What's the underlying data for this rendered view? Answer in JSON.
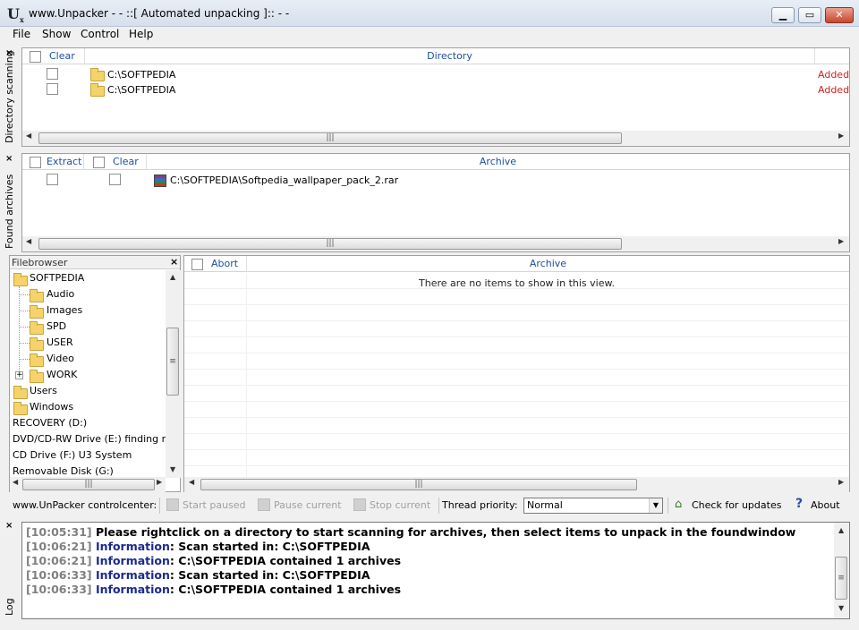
{
  "window": {
    "icon_text": "U",
    "icon_sub": "x",
    "title": "www.Unpacker - - ::[ Automated unpacking ]:: - -"
  },
  "menu": [
    "File",
    "Show",
    "Control",
    "Help"
  ],
  "directory_panel": {
    "side_label": "Directory scanning",
    "clear_label": "Clear",
    "directory_label": "Directory",
    "rows": [
      {
        "path": "C:\\SOFTPEDIA",
        "status": "Added"
      },
      {
        "path": "C:\\SOFTPEDIA",
        "status": "Added"
      }
    ]
  },
  "archives_panel": {
    "side_label": "Found archives",
    "extract_label": "Extract",
    "clear_label": "Clear",
    "archive_label": "Archive",
    "rows": [
      {
        "path": "C:\\SOFTPEDIA\\Softpedia_wallpaper_pack_2.rar"
      }
    ]
  },
  "filebrowser": {
    "title": "Filebrowser",
    "items": [
      {
        "label": "SOFTPEDIA",
        "folder": true
      },
      {
        "label": "Audio",
        "folder": true
      },
      {
        "label": "Images",
        "folder": true
      },
      {
        "label": "SPD",
        "folder": true
      },
      {
        "label": "USER",
        "folder": true
      },
      {
        "label": "Video",
        "folder": true
      },
      {
        "label": "WORK",
        "folder": true
      },
      {
        "label": "Users",
        "folder": true
      },
      {
        "label": "Windows",
        "folder": true
      },
      {
        "label": "RECOVERY (D:)",
        "folder": false
      },
      {
        "label": "DVD/CD-RW Drive (E:) finding ne",
        "folder": false
      },
      {
        "label": "CD Drive (F:) U3 System",
        "folder": false
      },
      {
        "label": "Removable Disk (G:)",
        "folder": false
      }
    ]
  },
  "unpack_panel": {
    "abort_label": "Abort",
    "archive_label": "Archive",
    "empty_text": "There are no items to show in this view."
  },
  "toolbar": {
    "controlcenter_label": "www.UnPacker controlcenter:",
    "start_paused": "Start paused",
    "pause_current": "Pause current",
    "stop_current": "Stop current",
    "thread_priority_label": "Thread priority:",
    "thread_priority_value": "Normal",
    "check_updates": "Check for updates",
    "about": "About"
  },
  "log": {
    "side_label": "Log",
    "lines": [
      {
        "time": "[10:05:31]",
        "kind": "",
        "text": "Please rightclick on a directory to start scanning for archives, then select items to unpack in the foundwindow"
      },
      {
        "time": "[10:06:21]",
        "kind": "Information",
        "text": ": Scan started in: C:\\SOFTPEDIA"
      },
      {
        "time": "[10:06:21]",
        "kind": "Information",
        "text": ": C:\\SOFTPEDIA contained 1 archives"
      },
      {
        "time": "[10:06:33]",
        "kind": "Information",
        "text": ": Scan started in: C:\\SOFTPEDIA"
      },
      {
        "time": "[10:06:33]",
        "kind": "Information",
        "text": ": C:\\SOFTPEDIA contained 1 archives"
      }
    ]
  }
}
